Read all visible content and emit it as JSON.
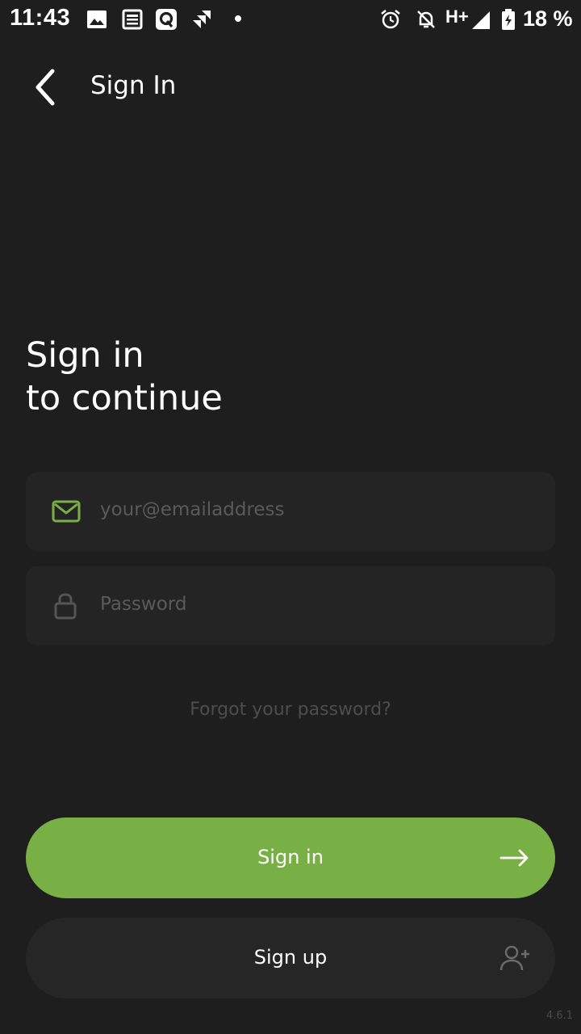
{
  "status_bar": {
    "time": "11:43",
    "network": "H+",
    "battery": "18 %",
    "icons": [
      "image-icon",
      "news-icon",
      "quora-icon",
      "jira-icon",
      "dot-icon",
      "alarm-icon",
      "notifications-off-icon",
      "signal-icon",
      "battery-charging-icon"
    ]
  },
  "app_bar": {
    "title": "Sign In",
    "back_icon": "chevron-left-icon"
  },
  "heading": {
    "line1": "Sign in",
    "line2": "to continue"
  },
  "email_field": {
    "placeholder": "your@emailaddress",
    "icon": "mail-icon"
  },
  "password_field": {
    "placeholder": "Password",
    "icon": "lock-icon"
  },
  "forgot_link": "Forgot your password?",
  "sign_in_button": {
    "label": "Sign in",
    "icon": "arrow-right-icon"
  },
  "sign_up_button": {
    "label": "Sign up",
    "icon": "add-user-icon"
  },
  "version": "4.6.1",
  "colors": {
    "background": "#1e1e1e",
    "field_background": "#242424",
    "accent": "#79b045",
    "secondary_button": "#262626",
    "placeholder_text": "#5a5a5a"
  }
}
